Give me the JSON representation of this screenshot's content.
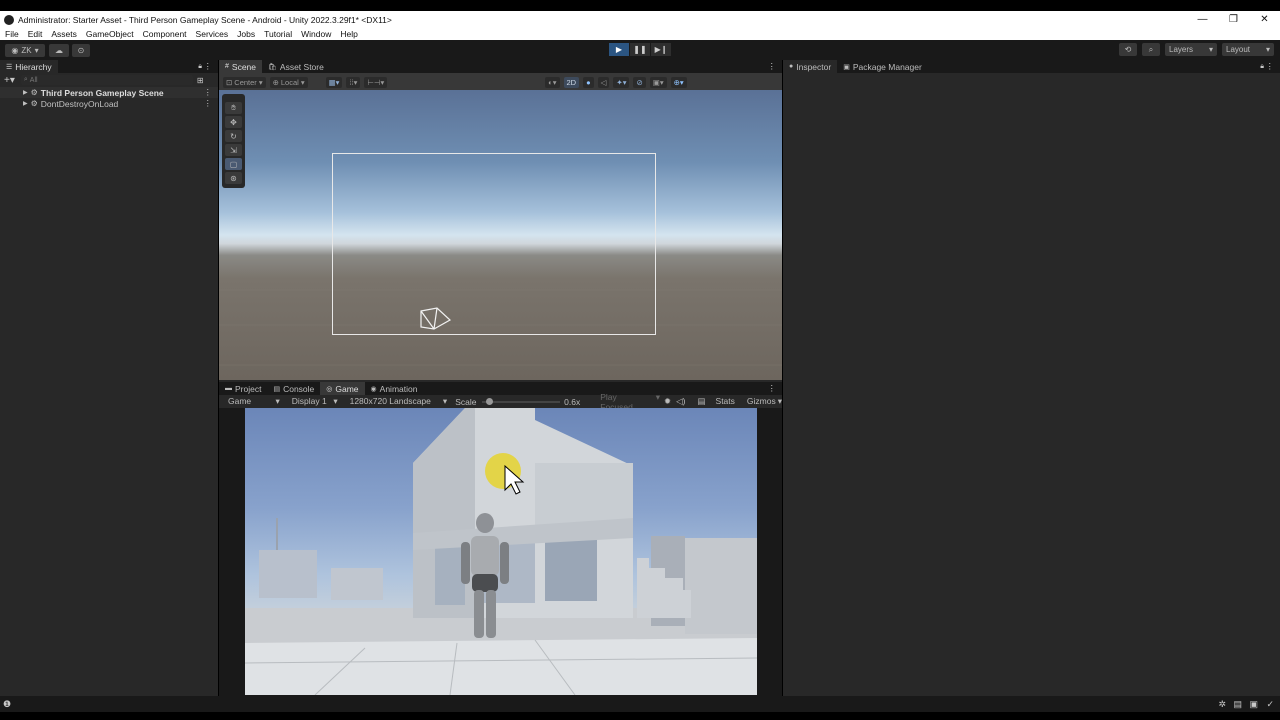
{
  "window": {
    "title": "Administrator: Starter Asset - Third Person Gameplay Scene - Android - Unity 2022.3.29f1* <DX11>",
    "controls": [
      "—",
      "❐",
      "✕"
    ]
  },
  "menu": [
    "File",
    "Edit",
    "Assets",
    "GameObject",
    "Component",
    "Services",
    "Jobs",
    "Tutorial",
    "Window",
    "Help"
  ],
  "toolbar": {
    "account": "ZK",
    "layers": "Layers",
    "layout": "Layout"
  },
  "hierarchy": {
    "tab": "Hierarchy",
    "search_placeholder": "All",
    "items": [
      "Third Person Gameplay Scene",
      "DontDestroyOnLoad"
    ]
  },
  "scene_panel": {
    "tabs": [
      "Scene",
      "Asset Store"
    ],
    "pivot": "Center",
    "space": "Local",
    "mode_2d": "2D"
  },
  "inspector_panel": {
    "tabs": [
      "Inspector",
      "Package Manager"
    ]
  },
  "bottom_panel": {
    "tabs": [
      "Project",
      "Console",
      "Game",
      "Animation"
    ],
    "game_toolbar": {
      "view": "Game",
      "display": "Display 1",
      "resolution": "1280x720 Landscape",
      "scale_label": "Scale",
      "scale_value": "0.6x",
      "play_mode": "Play Focused",
      "stats": "Stats",
      "gizmos": "Gizmos"
    }
  },
  "colors": {
    "accent_play": "#2b5582",
    "editor_bg": "#282828",
    "panel_bg": "#383838"
  }
}
